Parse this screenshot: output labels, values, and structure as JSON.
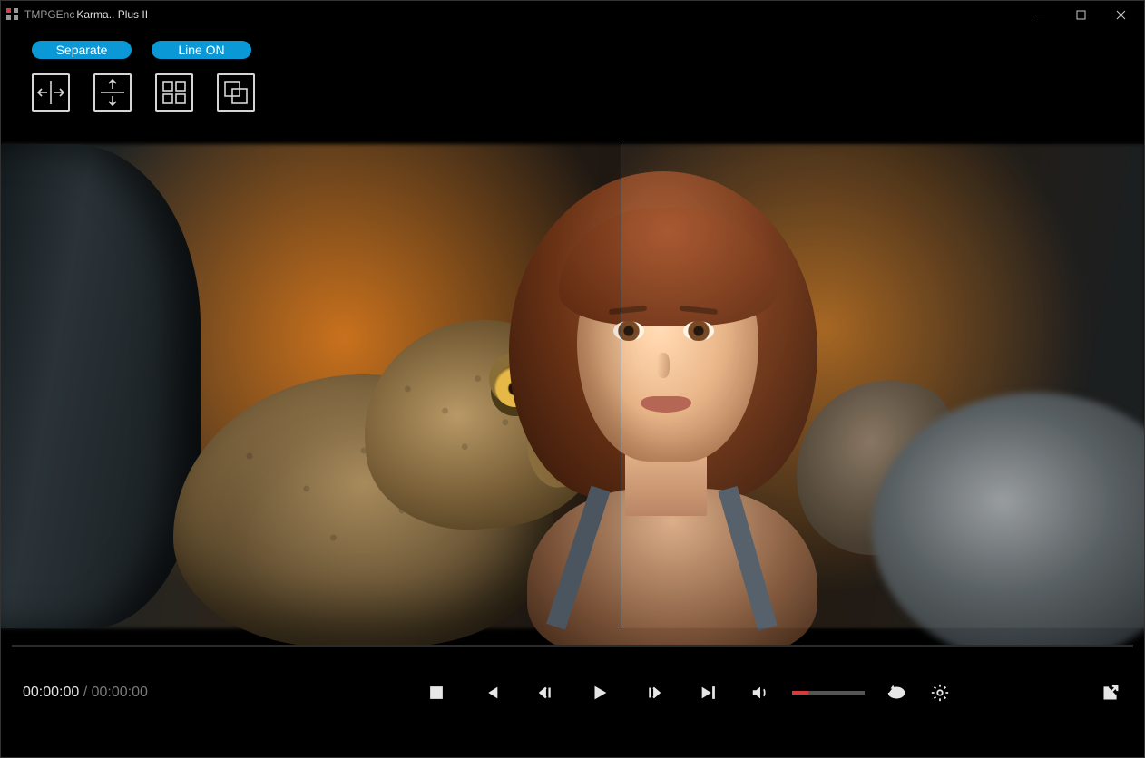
{
  "window": {
    "title_prefix": "TMPGEnc",
    "title_main": "Karma.. Plus II"
  },
  "toolbar": {
    "separate_label": "Separate",
    "line_label": "Line ON",
    "modes": {
      "split_horizontal": "split-horizontal",
      "split_vertical": "split-vertical",
      "grid_2x2": "grid-2x2",
      "overlay": "overlay"
    }
  },
  "preview": {
    "split_position_percent": 54
  },
  "playback": {
    "time_current": "00:00:00",
    "time_separator": " / ",
    "time_total": "00:00:00",
    "volume_percent": 22
  }
}
